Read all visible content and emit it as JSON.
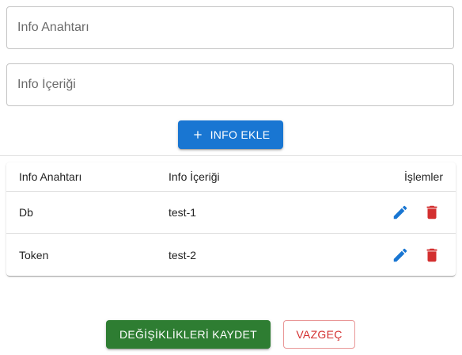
{
  "form": {
    "key_field": {
      "placeholder": "Info Anahtarı",
      "value": ""
    },
    "value_field": {
      "placeholder": "Info İçeriği",
      "value": ""
    },
    "add_button": {
      "label": "INFO EKLE",
      "icon": "plus-icon",
      "color": "#1976d2"
    }
  },
  "table": {
    "columns": [
      "Info Anahtarı",
      "Info İçeriği",
      "İşlemler"
    ],
    "rows": [
      {
        "key": "Db",
        "value": "test-1"
      },
      {
        "key": "Token",
        "value": "test-2"
      }
    ],
    "row_actions": [
      {
        "icon": "edit-icon",
        "color": "#1976d2"
      },
      {
        "icon": "delete-icon",
        "color": "#d32f2f"
      }
    ]
  },
  "footer": {
    "save_button": {
      "label": "DEĞİŞİKLİKLERİ KAYDET",
      "color": "#2e7d32"
    },
    "cancel_button": {
      "label": "VAZGEÇ",
      "color": "#d32f2f"
    }
  }
}
